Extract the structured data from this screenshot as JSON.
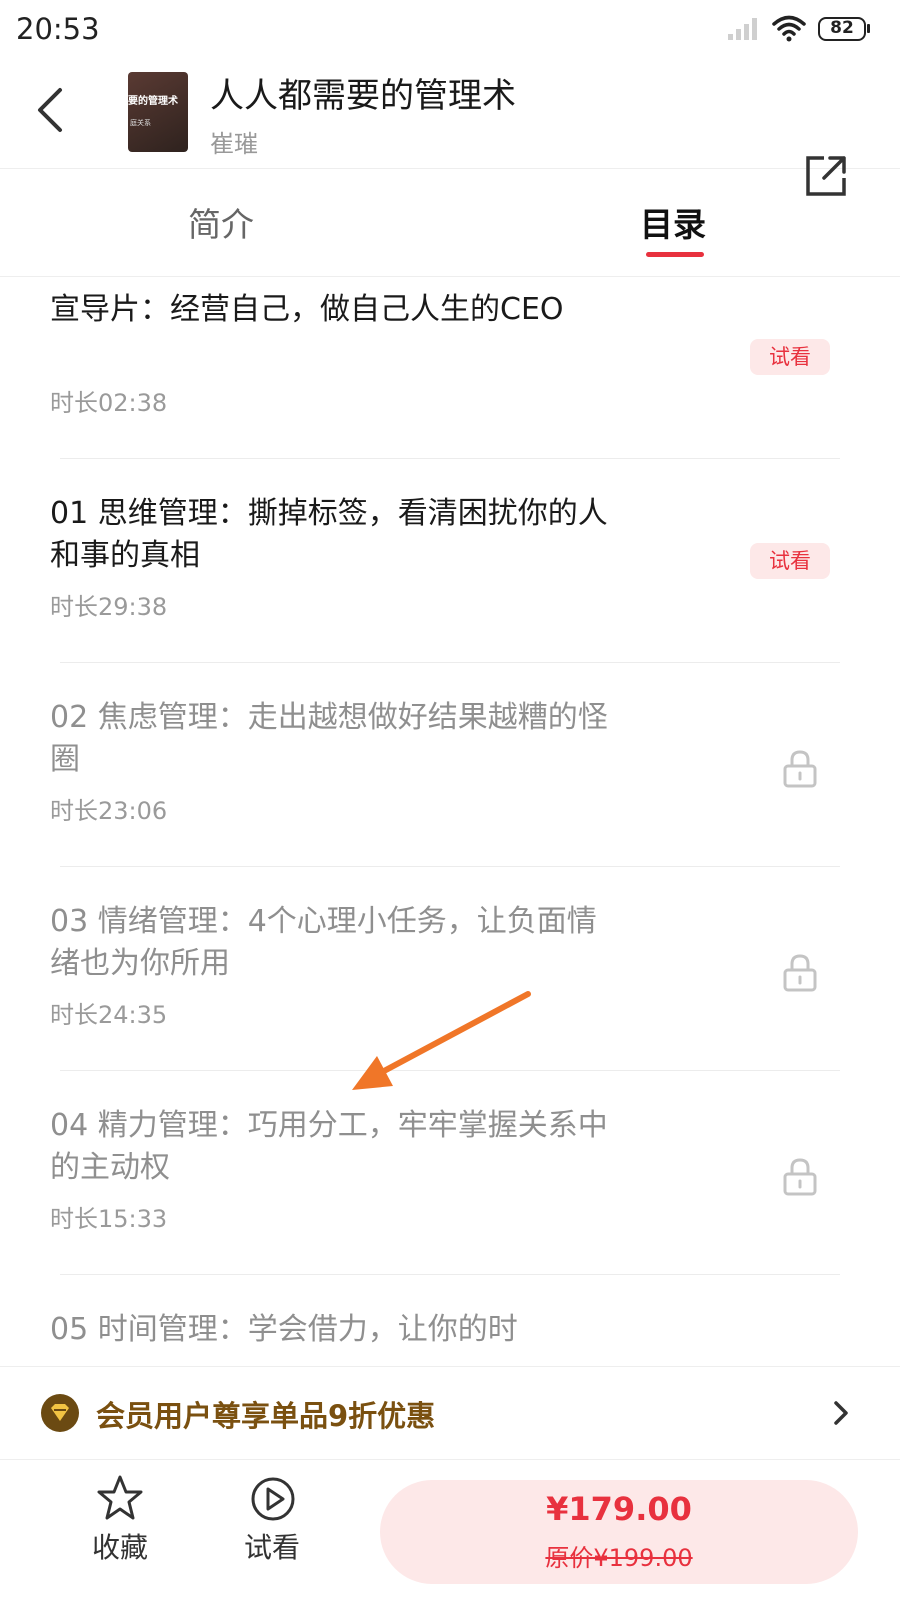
{
  "status_bar": {
    "time": "20:53",
    "battery": "82"
  },
  "header": {
    "title": "人人都需要的管理术",
    "author": "崔璀",
    "cover_text_1": "要的管理术",
    "cover_text_2": "庭关系"
  },
  "tabs": {
    "intro": "简介",
    "toc": "目录",
    "active": "目录"
  },
  "items": [
    {
      "title": "宣导片：经营自己，做自己人生的CEO",
      "duration": "时长02:38",
      "tag": "试看",
      "locked": false
    },
    {
      "title": "01 思维管理：撕掉标签，看清困扰你的人和事的真相",
      "duration": "时长29:38",
      "tag": "试看",
      "locked": false
    },
    {
      "title": "02 焦虑管理：走出越想做好结果越糟的怪圈",
      "duration": "时长23:06",
      "locked": true
    },
    {
      "title": "03 情绪管理：4个心理小任务，让负面情绪也为你所用",
      "duration": "时长24:35",
      "locked": true
    },
    {
      "title": "04 精力管理：巧用分工，牢牢掌握关系中的主动权",
      "duration": "时长15:33",
      "locked": true
    },
    {
      "title": "05 时间管理：学会借力，让你的时",
      "locked": true
    }
  ],
  "promo": {
    "text": "会员用户尊享单品9折优惠"
  },
  "bottom_bar": {
    "favorite_label": "收藏",
    "preview_label": "试看",
    "price": "¥179.00",
    "original_price": "原价¥199.00"
  },
  "colors": {
    "accent": "#e8313e",
    "tag_bg": "#fde8e8",
    "promo_text": "#7a5010",
    "promo_icon": "#6b4a12"
  }
}
